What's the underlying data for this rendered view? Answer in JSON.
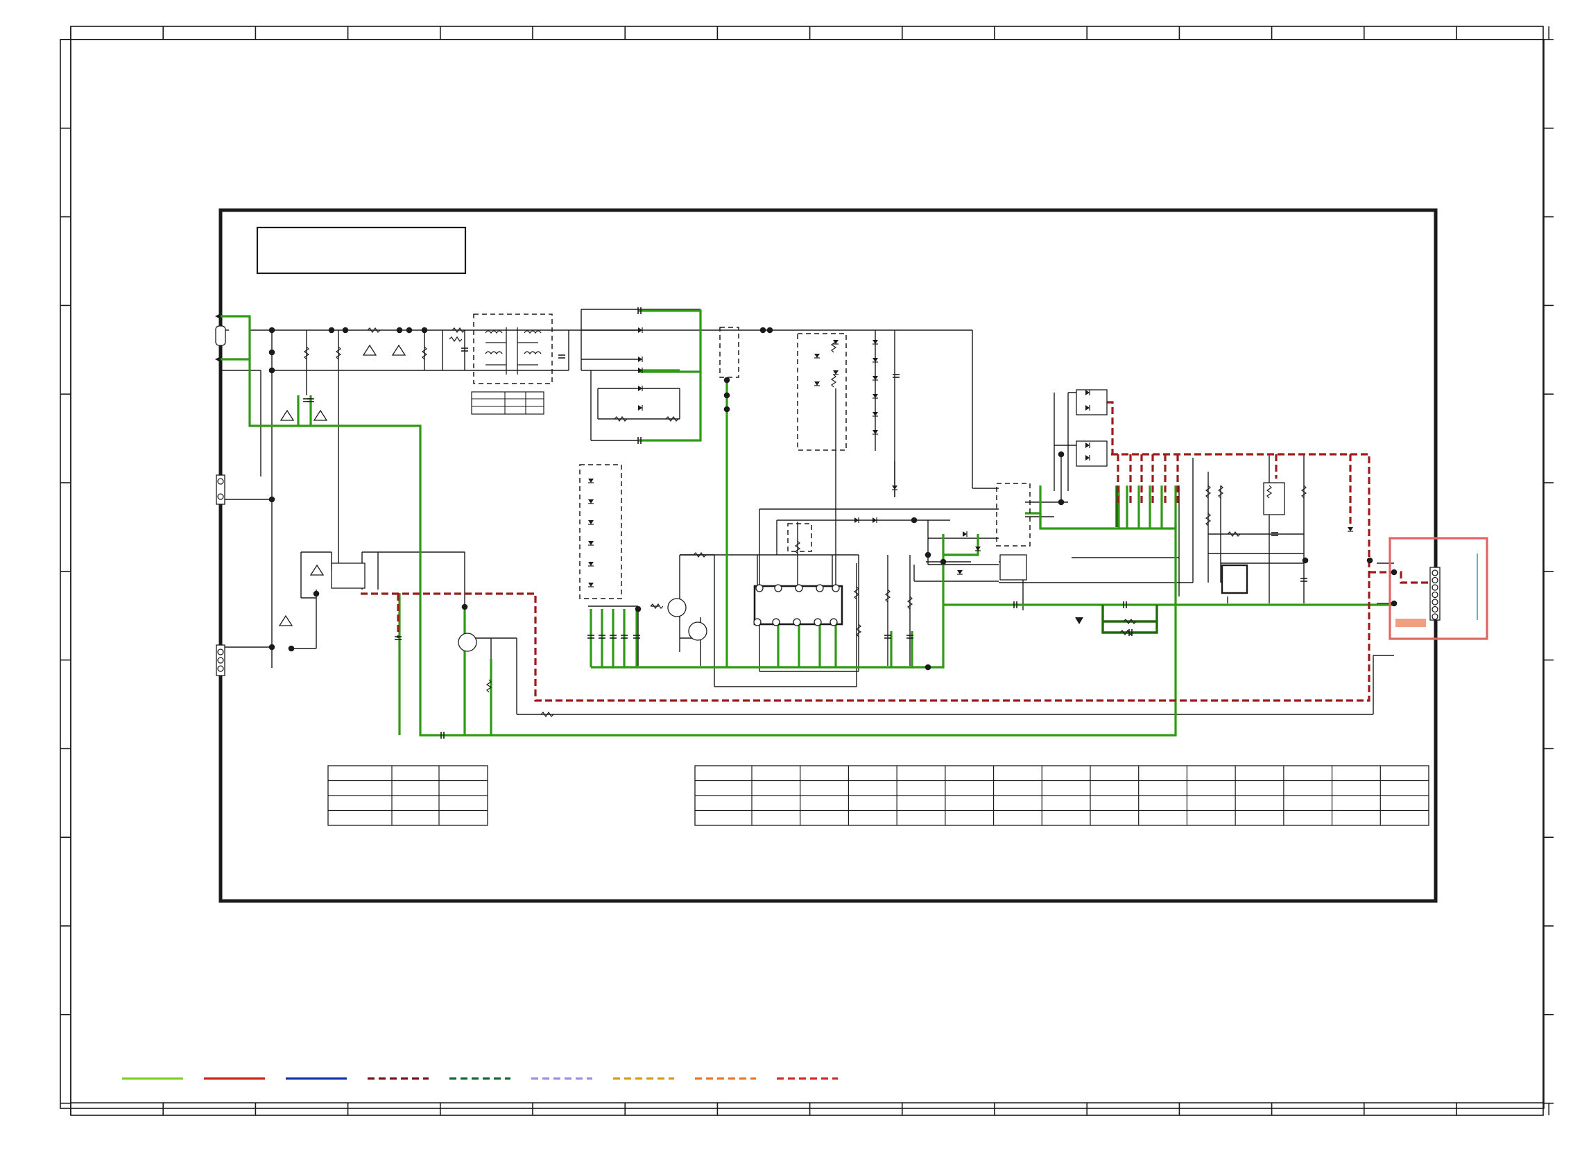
{
  "diagram": {
    "kind": "power-supply schematic",
    "colors": {
      "line": "#1a1a1a",
      "trace_green": "#2f9a14",
      "trace_dark_green": "#1f6b0a",
      "trace_red_dashed": "#9c1c1c",
      "highlight_box": "#e06666",
      "highlight_fill": "#f0a080",
      "cyan_marker": "#59b8c8"
    },
    "legend_lines": [
      {
        "color": "#7bd32a",
        "style": "solid"
      },
      {
        "color": "#cc2a1e",
        "style": "solid"
      },
      {
        "color": "#1837b0",
        "style": "solid"
      },
      {
        "color": "#7a1a1a",
        "style": "dashed"
      },
      {
        "color": "#1d6b35",
        "style": "dashed"
      },
      {
        "color": "#9a94e6",
        "style": "dashed"
      },
      {
        "color": "#d4a020",
        "style": "dashed"
      },
      {
        "color": "#e87a30",
        "style": "dashed"
      },
      {
        "color": "#d43030",
        "style": "dashed"
      }
    ],
    "tables": [
      {
        "id": "small-left",
        "rows": 4,
        "cols": 3
      },
      {
        "id": "wide-right",
        "rows": 4,
        "cols": 15
      },
      {
        "id": "tiny-filter",
        "rows": 3,
        "cols": 3
      }
    ]
  }
}
